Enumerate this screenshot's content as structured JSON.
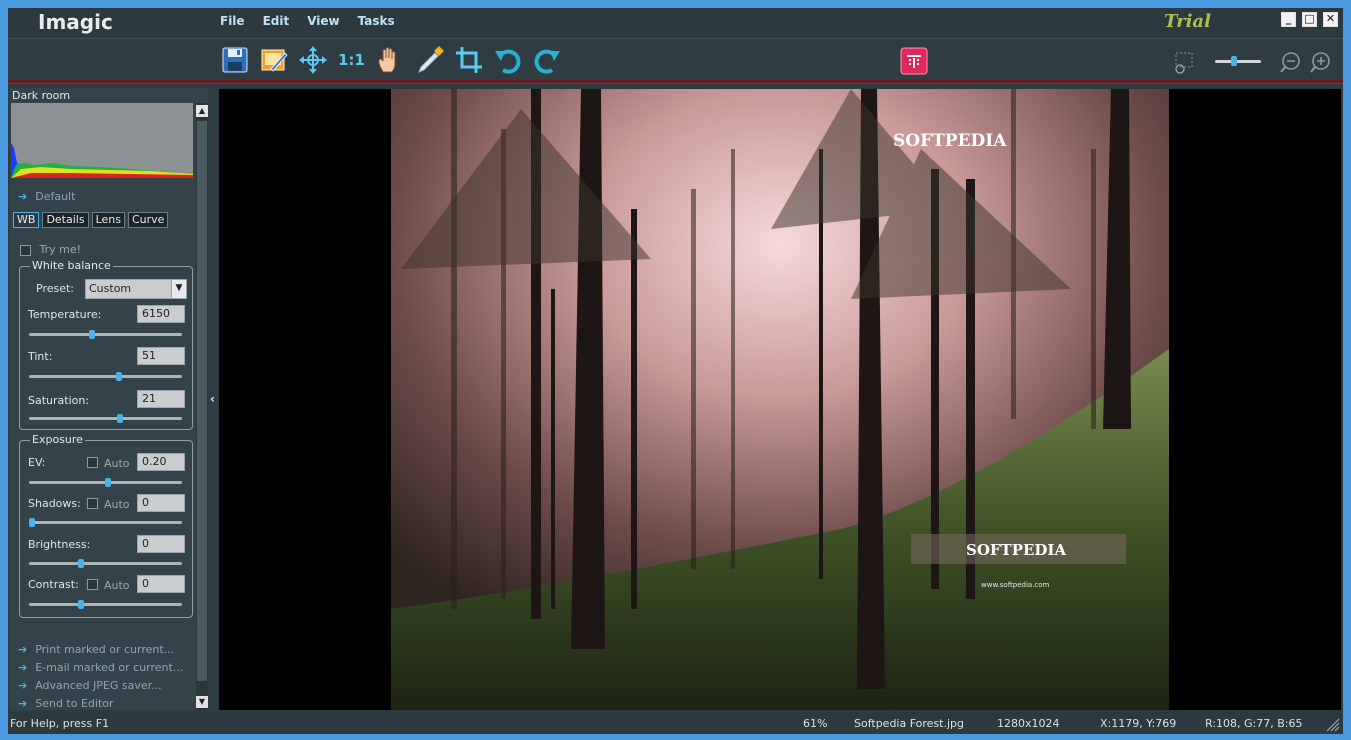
{
  "app": {
    "title": "Imagic",
    "trial_label": "Trial"
  },
  "menu": [
    "File",
    "Edit",
    "View",
    "Tasks"
  ],
  "window_controls": {
    "minimize": "_",
    "maximize": "□",
    "close": "✕"
  },
  "toolbar": {
    "actual_size_label": "1:1",
    "icons": [
      "save-icon",
      "edit-image-icon",
      "fit-move-icon",
      "actual-size-icon",
      "hand-pan-icon",
      "eyedropper-icon",
      "crop-icon",
      "rotate-left-icon",
      "rotate-right-icon",
      "red-tool-icon",
      "selection-icon",
      "zoom-slider",
      "zoom-out-icon",
      "zoom-in-icon"
    ],
    "zoom_level": 0.4
  },
  "panel": {
    "title": "Dark room",
    "default_link": "Default",
    "tabs": [
      "WB",
      "Details",
      "Lens",
      "Curve"
    ],
    "active_tab": "WB",
    "try_me": "Try me!",
    "white_balance": {
      "group": "White balance",
      "preset_label": "Preset:",
      "preset_value": "Custom",
      "temperature_label": "Temperature:",
      "temperature_value": "6150",
      "temperature_level": 0.41,
      "tint_label": "Tint:",
      "tint_value": "51",
      "tint_level": 0.59,
      "saturation_label": "Saturation:",
      "saturation_value": "21",
      "saturation_level": 0.6
    },
    "exposure": {
      "group": "Exposure",
      "auto_label": "Auto",
      "ev_label": "EV:",
      "ev_value": "0.20",
      "ev_level": 0.52,
      "shadows_label": "Shadows:",
      "shadows_value": "0",
      "shadows_level": 0.0,
      "brightness_label": "Brightness:",
      "brightness_value": "0",
      "brightness_level": 0.33,
      "contrast_label": "Contrast:",
      "contrast_value": "0",
      "contrast_level": 0.33
    },
    "actions": [
      "Print marked or current...",
      "E-mail marked or current...",
      "Advanced JPEG saver...",
      "Send to Editor"
    ]
  },
  "image": {
    "watermark_top": "SOFTPEDIA",
    "watermark_bottom": "SOFTPEDIA",
    "watermark_url": "www.softpedia.com"
  },
  "status": {
    "help": "For Help, press F1",
    "zoom": "61%",
    "filename": "Softpedia Forest.jpg",
    "dimensions": "1280x1024",
    "coords": "X:1179, Y:769",
    "rgb": "R:108, G:77, B:65"
  },
  "colors": {
    "accent": "#4bb4e6",
    "trial": "#a8c24a",
    "panel": "#34434a"
  }
}
